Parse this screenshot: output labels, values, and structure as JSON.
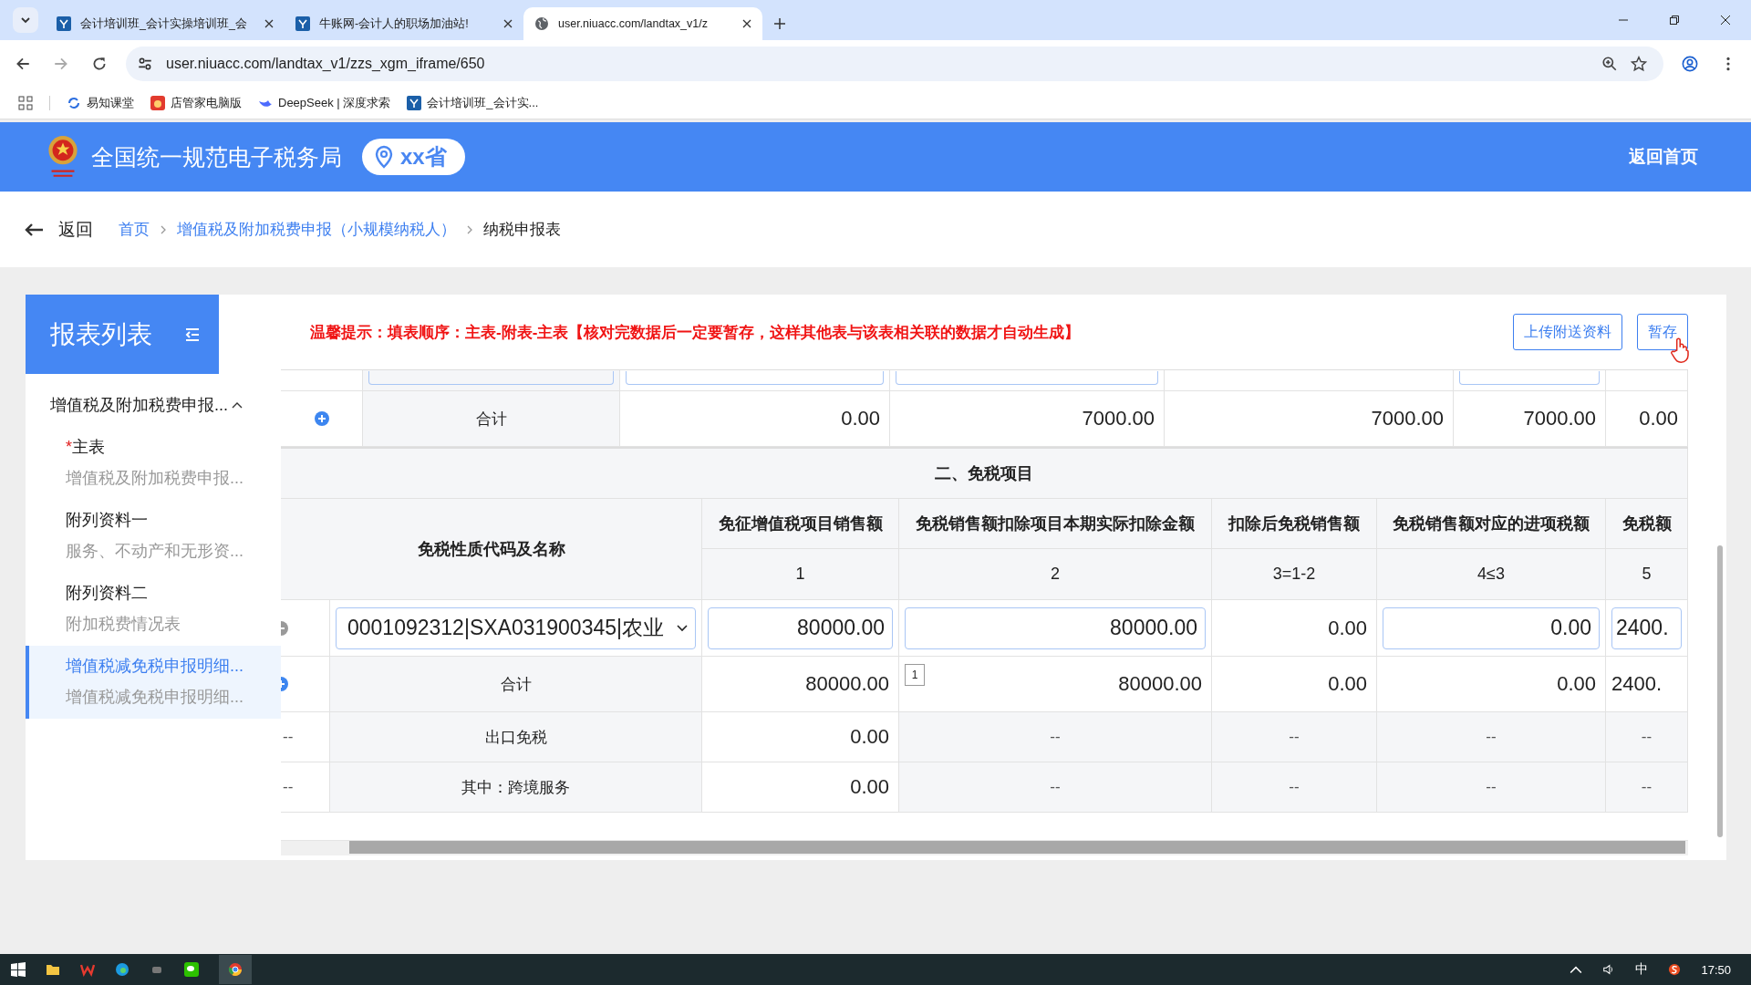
{
  "browser": {
    "tabs": [
      {
        "title": "会计培训班_会计实操培训班_会",
        "selected": false
      },
      {
        "title": "牛账网-会计人的职场加油站!",
        "selected": false
      },
      {
        "title": "user.niuacc.com/landtax_v1/z",
        "selected": true
      }
    ],
    "url": "user.niuacc.com/landtax_v1/zzs_xgm_iframe/650",
    "bookmarks": [
      "易知课堂",
      "店管家电脑版",
      "DeepSeek | 深度求索",
      "会计培训班_会计实..."
    ]
  },
  "header": {
    "title": "全国统一规范电子税务局",
    "province": "xx省",
    "home_link": "返回首页"
  },
  "breadcrumb": {
    "back": "返回",
    "items": [
      "首页",
      "增值税及附加税费申报（小规模纳税人）",
      "纳税申报表"
    ]
  },
  "sidebar": {
    "title": "报表列表",
    "group": {
      "label": "增值税及附加税费申报...",
      "expanded": true,
      "items": [
        {
          "name": "主表",
          "required_mark": "*",
          "subtitle": "增值税及附加税费申报...",
          "selected": false
        },
        {
          "name": "附列资料一",
          "subtitle": "服务、不动产和无形资...",
          "selected": false
        },
        {
          "name": "附列资料二",
          "subtitle": "附加税费情况表",
          "selected": false
        },
        {
          "name": "增值税减免税申报明细...",
          "subtitle": "增值税减免税申报明细...",
          "selected": true
        }
      ]
    }
  },
  "tip": "温馨提示：填表顺序：主表-附表-主表【核对完数据后一定要暂存，这样其他表与该表相关联的数据才自动生成】",
  "buttons": [
    "上传附送资料",
    "暂存"
  ],
  "reduction_total": {
    "label": "合计",
    "values": [
      "0.00",
      "7000.00",
      "7000.00",
      "7000.00",
      "0.00"
    ]
  },
  "exempt": {
    "title": "二、免税项目",
    "name_header": "免税性质代码及名称",
    "columns": [
      {
        "header": "免征增值税项目销售额",
        "index": "1"
      },
      {
        "header": "免税销售额扣除项目本期实际扣除金额",
        "index": "2"
      },
      {
        "header": "扣除后免税销售额",
        "index": "3=1-2"
      },
      {
        "header": "免税销售额对应的进项税额",
        "index": "4≤3"
      },
      {
        "header": "免税额",
        "index": "5"
      }
    ],
    "rows": [
      {
        "kind": "entry",
        "code": "0001092312|SXA031900345|农业",
        "values": [
          {
            "text": "80000.00",
            "editable": true
          },
          {
            "text": "80000.00",
            "editable": true
          },
          {
            "text": "0.00",
            "editable": false
          },
          {
            "text": "0.00",
            "editable": true
          },
          {
            "text": "2400.",
            "editable": true
          }
        ]
      },
      {
        "kind": "total",
        "label": "合计",
        "note": "1",
        "values": [
          {
            "text": "80000.00",
            "editable": false
          },
          {
            "text": "80000.00",
            "editable": false
          },
          {
            "text": "0.00",
            "editable": false
          },
          {
            "text": "0.00",
            "editable": false
          },
          {
            "text": "2400.",
            "editable": false
          }
        ]
      },
      {
        "kind": "plain",
        "lead": "--",
        "label": "出口免税",
        "values": [
          {
            "text": "0.00",
            "editable": false
          },
          {
            "text": "--",
            "editable": false
          },
          {
            "text": "--",
            "editable": false
          },
          {
            "text": "--",
            "editable": false
          },
          {
            "text": "--",
            "editable": false
          }
        ]
      },
      {
        "kind": "plain",
        "lead": "--",
        "label": "其中：跨境服务",
        "values": [
          {
            "text": "0.00",
            "editable": false
          },
          {
            "text": "--",
            "editable": false
          },
          {
            "text": "--",
            "editable": false
          },
          {
            "text": "--",
            "editable": false
          },
          {
            "text": "--",
            "editable": false
          }
        ]
      }
    ]
  },
  "taskbar": {
    "ime": "中",
    "time": "17:50"
  }
}
